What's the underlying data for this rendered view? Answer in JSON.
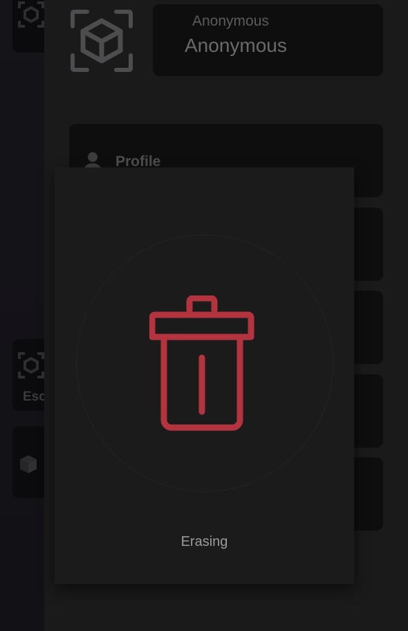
{
  "background": {
    "account": {
      "username_small": "Anonymous",
      "username_large": "Anonymous"
    },
    "menu": {
      "profile_label": "Profile"
    },
    "sidebar": {
      "partial_label": "Esc"
    }
  },
  "dialog": {
    "status_text": "Erasing",
    "icon": "trash-icon",
    "accent_color": "#b3343f"
  }
}
